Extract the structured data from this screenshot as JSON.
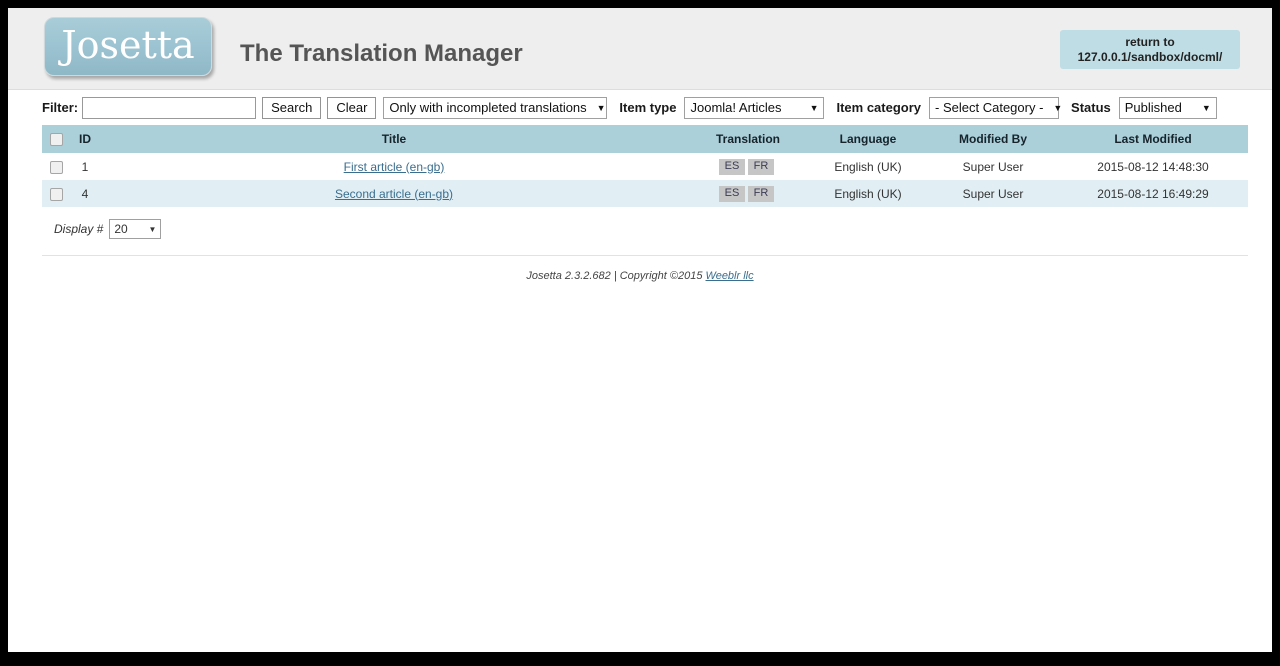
{
  "header": {
    "logo_text": "Josetta",
    "app_title": "The Translation Manager",
    "return_button": {
      "line1": "return to",
      "line2": "127.0.0.1/sandbox/docml/"
    }
  },
  "toolbar": {
    "filter_label": "Filter:",
    "filter_value": "",
    "filter_placeholder": "",
    "search_label": "Search",
    "clear_label": "Clear",
    "completion_select": "Only with incompleted translations",
    "item_type_label": "Item type",
    "item_type_select": "Joomla! Articles",
    "item_category_label": "Item category",
    "item_category_select": "- Select Category -",
    "status_label": "Status",
    "status_select": "Published",
    "caret": "▼"
  },
  "table": {
    "columns": {
      "id": "ID",
      "title": "Title",
      "translation": "Translation",
      "language": "Language",
      "modified_by": "Modified By",
      "last_modified": "Last Modified"
    },
    "rows": [
      {
        "id": "1",
        "title": "First article (en-gb)",
        "translations": [
          "ES",
          "FR"
        ],
        "language": "English (UK)",
        "modified_by": "Super User",
        "last_modified": "2015-08-12 14:48:30"
      },
      {
        "id": "4",
        "title": "Second article (en-gb)",
        "translations": [
          "ES",
          "FR"
        ],
        "language": "English (UK)",
        "modified_by": "Super User",
        "last_modified": "2015-08-12 16:49:29"
      }
    ]
  },
  "pagination": {
    "display_label": "Display #",
    "display_value": "20",
    "caret": "▼"
  },
  "footer": {
    "text": "Josetta 2.3.2.682 | Copyright ©2015 ",
    "link": "Weeblr llc"
  },
  "colors": {
    "header_bg": "#eeeeee",
    "logo_blue": "#9dc4d2",
    "table_header_bg": "#abd0da",
    "row_alt_bg": "#e1eff4",
    "accent_button": "#bfdde5",
    "link": "#3a6e8f",
    "badge_bg": "#c6c6c6"
  }
}
